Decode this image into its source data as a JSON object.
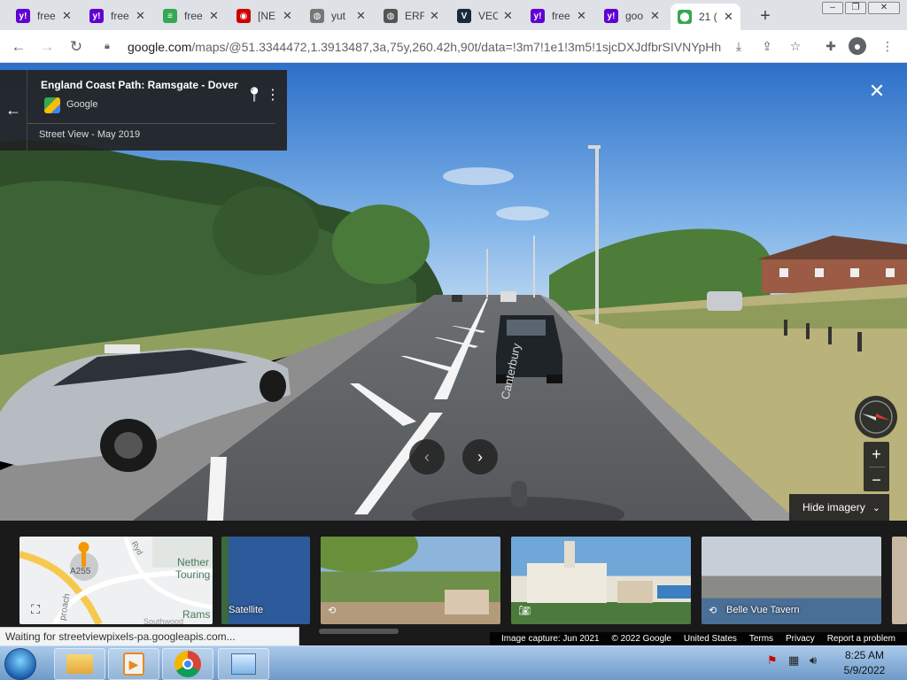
{
  "browser": {
    "tabs": [
      {
        "favicon": "yahoo-icon",
        "fav_text": "y!",
        "fav_color": "#6001d2",
        "title": "free"
      },
      {
        "favicon": "yahoo-icon",
        "fav_text": "y!",
        "fav_color": "#6001d2",
        "title": "free"
      },
      {
        "favicon": "document-search-icon",
        "fav_text": "≡",
        "fav_color": "#34a853",
        "title": "free"
      },
      {
        "favicon": "news-icon",
        "fav_text": "◉",
        "fav_color": "#cc0000",
        "title": "[NE"
      },
      {
        "favicon": "globe-icon",
        "fav_text": "◍",
        "fav_color": "#777777",
        "title": "yut"
      },
      {
        "favicon": "globe-icon",
        "fav_text": "◍",
        "fav_color": "#555555",
        "title": "ERF"
      },
      {
        "favicon": "v-icon",
        "fav_text": "V",
        "fav_color": "#1b2a3a",
        "title": "VEC"
      },
      {
        "favicon": "yahoo-icon",
        "fav_text": "y!",
        "fav_color": "#6001d2",
        "title": "free"
      },
      {
        "favicon": "yahoo-icon",
        "fav_text": "y!",
        "fav_color": "#6001d2",
        "title": "goo"
      },
      {
        "favicon": "maps-pin-icon",
        "fav_text": "⬤",
        "fav_color": "#34a853",
        "title": "21 (",
        "active": true
      }
    ],
    "newtab": "+",
    "url_host": "google.com",
    "url_path": "/maps/@51.3344472,1.3913487,3a,75y,260.42h,90t/data=!3m7!1e1!3m5!1sjcDXJdfbrSIVNYpHh..."
  },
  "streetview": {
    "title": "England Coast Path: Ramsgate - Dover",
    "source": "Google",
    "date": "Street View - May 2019",
    "road_marking": "Canterbury",
    "hide_imagery": "Hide imagery",
    "zoom_in": "+",
    "zoom_out": "−",
    "close": "✕"
  },
  "imagery": {
    "map_labels": [
      "A255",
      "Nether",
      "Touring",
      "Rams",
      "Ryd",
      "proach",
      "Southwood"
    ],
    "thumbnails": [
      {
        "label": "Satellite"
      },
      {
        "label": ""
      },
      {
        "label": ""
      },
      {
        "label": "Belle Vue Tavern"
      },
      {
        "label": ""
      }
    ]
  },
  "status_text": "Waiting for streetviewpixels-pa.googleapis.com...",
  "footer": {
    "capture": "Image capture: Jun 2021",
    "copyright": "© 2022 Google",
    "country": "United States",
    "terms": "Terms",
    "privacy": "Privacy",
    "report": "Report a problem"
  },
  "taskbar": {
    "time": "8:25 AM",
    "date": "5/9/2022"
  }
}
